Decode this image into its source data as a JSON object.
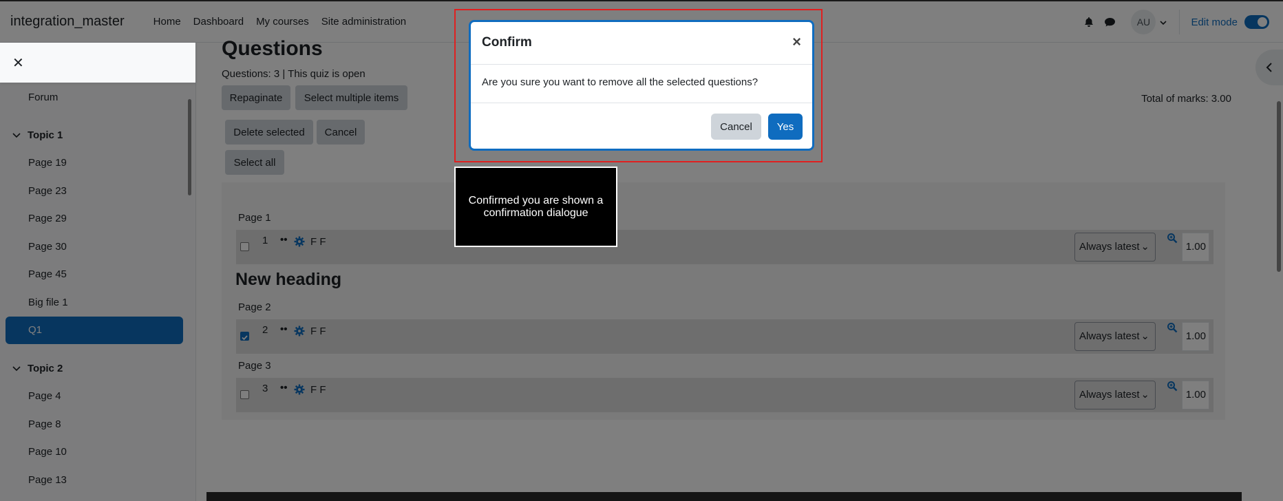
{
  "navbar": {
    "brand": "integration_master",
    "links": [
      "Home",
      "Dashboard",
      "My courses",
      "Site administration"
    ],
    "avatar": "AU",
    "edit_mode_label": "Edit mode"
  },
  "drawer": {
    "items_top": [
      "Forum"
    ],
    "topic1": {
      "title": "Topic 1",
      "items": [
        "Page 19",
        "Page 23",
        "Page 29",
        "Page 30",
        "Page 45",
        "Big file 1"
      ],
      "active": "Q1"
    },
    "topic2": {
      "title": "Topic 2",
      "items": [
        "Page 4",
        "Page 8",
        "Page 10",
        "Page 13"
      ]
    }
  },
  "main": {
    "title": "Questions",
    "info": "Questions: 3 | This quiz is open",
    "repaginate": "Repaginate",
    "select_multiple": "Select multiple items",
    "delete_selected": "Delete selected",
    "cancel": "Cancel",
    "select_all": "Select all",
    "total_marks": "Total of marks: 3.00",
    "new_heading": "New heading",
    "pages": [
      {
        "label": "Page 1",
        "slot": {
          "num": "1",
          "checked": false,
          "ff": "F F",
          "version": "Always latest",
          "mark": "1.00"
        }
      },
      {
        "label": "Page 2",
        "slot": {
          "num": "2",
          "checked": true,
          "ff": "F F",
          "version": "Always latest",
          "mark": "1.00"
        }
      },
      {
        "label": "Page 3",
        "slot": {
          "num": "3",
          "checked": false,
          "ff": "F F",
          "version": "Always latest",
          "mark": "1.00"
        }
      }
    ]
  },
  "modal": {
    "title": "Confirm",
    "message": "Are you sure you want to remove all the selected questions?",
    "cancel": "Cancel",
    "yes": "Yes"
  },
  "annotation": "Confirmed you are shown a confirmation dialogue",
  "colors": {
    "primary": "#0f6cbf",
    "highlight": "#e02020"
  }
}
